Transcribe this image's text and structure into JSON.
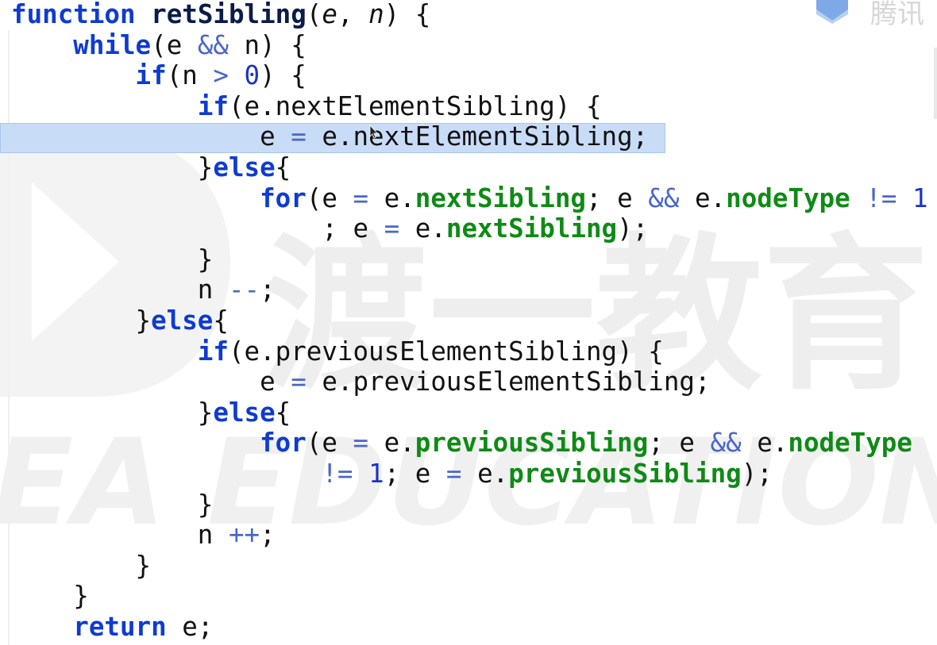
{
  "editor": {
    "lines": [
      [
        [
          "kw",
          "function"
        ],
        [
          "t",
          " "
        ],
        [
          "fn",
          "retSibling"
        ],
        [
          "t",
          "("
        ],
        [
          "param",
          "e"
        ],
        [
          "t",
          ", "
        ],
        [
          "param",
          "n"
        ],
        [
          "t",
          ") {"
        ]
      ],
      [
        [
          "t",
          "    "
        ],
        [
          "kw",
          "while"
        ],
        [
          "t",
          "(e "
        ],
        [
          "op",
          "&&"
        ],
        [
          "t",
          " n) {"
        ]
      ],
      [
        [
          "t",
          "        "
        ],
        [
          "kw",
          "if"
        ],
        [
          "t",
          "(n "
        ],
        [
          "op",
          ">"
        ],
        [
          "t",
          " "
        ],
        [
          "num",
          "0"
        ],
        [
          "t",
          ") {"
        ]
      ],
      [
        [
          "t",
          "            "
        ],
        [
          "kw",
          "if"
        ],
        [
          "t",
          "(e.nextElementSibling) {"
        ]
      ],
      [
        [
          "t",
          "                e "
        ],
        [
          "op",
          "="
        ],
        [
          "t",
          " e.nextElementSibling;"
        ]
      ],
      [
        [
          "t",
          "            }"
        ],
        [
          "kw",
          "else"
        ],
        [
          "t",
          "{"
        ]
      ],
      [
        [
          "t",
          "                "
        ],
        [
          "kw",
          "for"
        ],
        [
          "t",
          "(e "
        ],
        [
          "op",
          "="
        ],
        [
          "t",
          " e."
        ],
        [
          "prop",
          "nextSibling"
        ],
        [
          "t",
          "; e "
        ],
        [
          "op",
          "&&"
        ],
        [
          "t",
          " e."
        ],
        [
          "prop",
          "nodeType"
        ],
        [
          "t",
          " "
        ],
        [
          "op",
          "!="
        ],
        [
          "t",
          " "
        ],
        [
          "num",
          "1"
        ]
      ],
      [
        [
          "t",
          "                    ; e "
        ],
        [
          "op",
          "="
        ],
        [
          "t",
          " e."
        ],
        [
          "prop",
          "nextSibling"
        ],
        [
          "t",
          ");"
        ]
      ],
      [
        [
          "t",
          "            }"
        ]
      ],
      [
        [
          "t",
          "            n "
        ],
        [
          "op",
          "--"
        ],
        [
          "t",
          ";"
        ]
      ],
      [
        [
          "t",
          "        }"
        ],
        [
          "kw",
          "else"
        ],
        [
          "t",
          "{"
        ]
      ],
      [
        [
          "t",
          "            "
        ],
        [
          "kw",
          "if"
        ],
        [
          "t",
          "(e.previousElementSibling) {"
        ]
      ],
      [
        [
          "t",
          "                e "
        ],
        [
          "op",
          "="
        ],
        [
          "t",
          " e.previousElementSibling;"
        ]
      ],
      [
        [
          "t",
          "            }"
        ],
        [
          "kw",
          "else"
        ],
        [
          "t",
          "{"
        ]
      ],
      [
        [
          "t",
          "                "
        ],
        [
          "kw",
          "for"
        ],
        [
          "t",
          "(e "
        ],
        [
          "op",
          "="
        ],
        [
          "t",
          " e."
        ],
        [
          "prop",
          "previousSibling"
        ],
        [
          "t",
          "; e "
        ],
        [
          "op",
          "&&"
        ],
        [
          "t",
          " e."
        ],
        [
          "prop",
          "nodeType"
        ]
      ],
      [
        [
          "t",
          "                    "
        ],
        [
          "op",
          "!="
        ],
        [
          "t",
          " "
        ],
        [
          "num",
          "1"
        ],
        [
          "t",
          "; e "
        ],
        [
          "op",
          "="
        ],
        [
          "t",
          " e."
        ],
        [
          "prop",
          "previousSibling"
        ],
        [
          "t",
          ");"
        ]
      ],
      [
        [
          "t",
          "            }"
        ]
      ],
      [
        [
          "t",
          "            n "
        ],
        [
          "op",
          "++"
        ],
        [
          "t",
          ";"
        ]
      ],
      [
        [
          "t",
          "        }"
        ]
      ],
      [
        [
          "t",
          "    }"
        ]
      ],
      [
        [
          "t",
          "    "
        ],
        [
          "kw",
          "return"
        ],
        [
          "t",
          " e;"
        ]
      ]
    ],
    "highlighted_line": 5
  },
  "brand": {
    "logo_text": "腾讯",
    "watermark_text": "渡一教育",
    "watermark_sub": "EA EDUCATION"
  },
  "colors": {
    "keyword": "#0e3bd1",
    "property": "#0f8a16",
    "number": "#1a34c8",
    "highlight": "#c9dcf7"
  }
}
